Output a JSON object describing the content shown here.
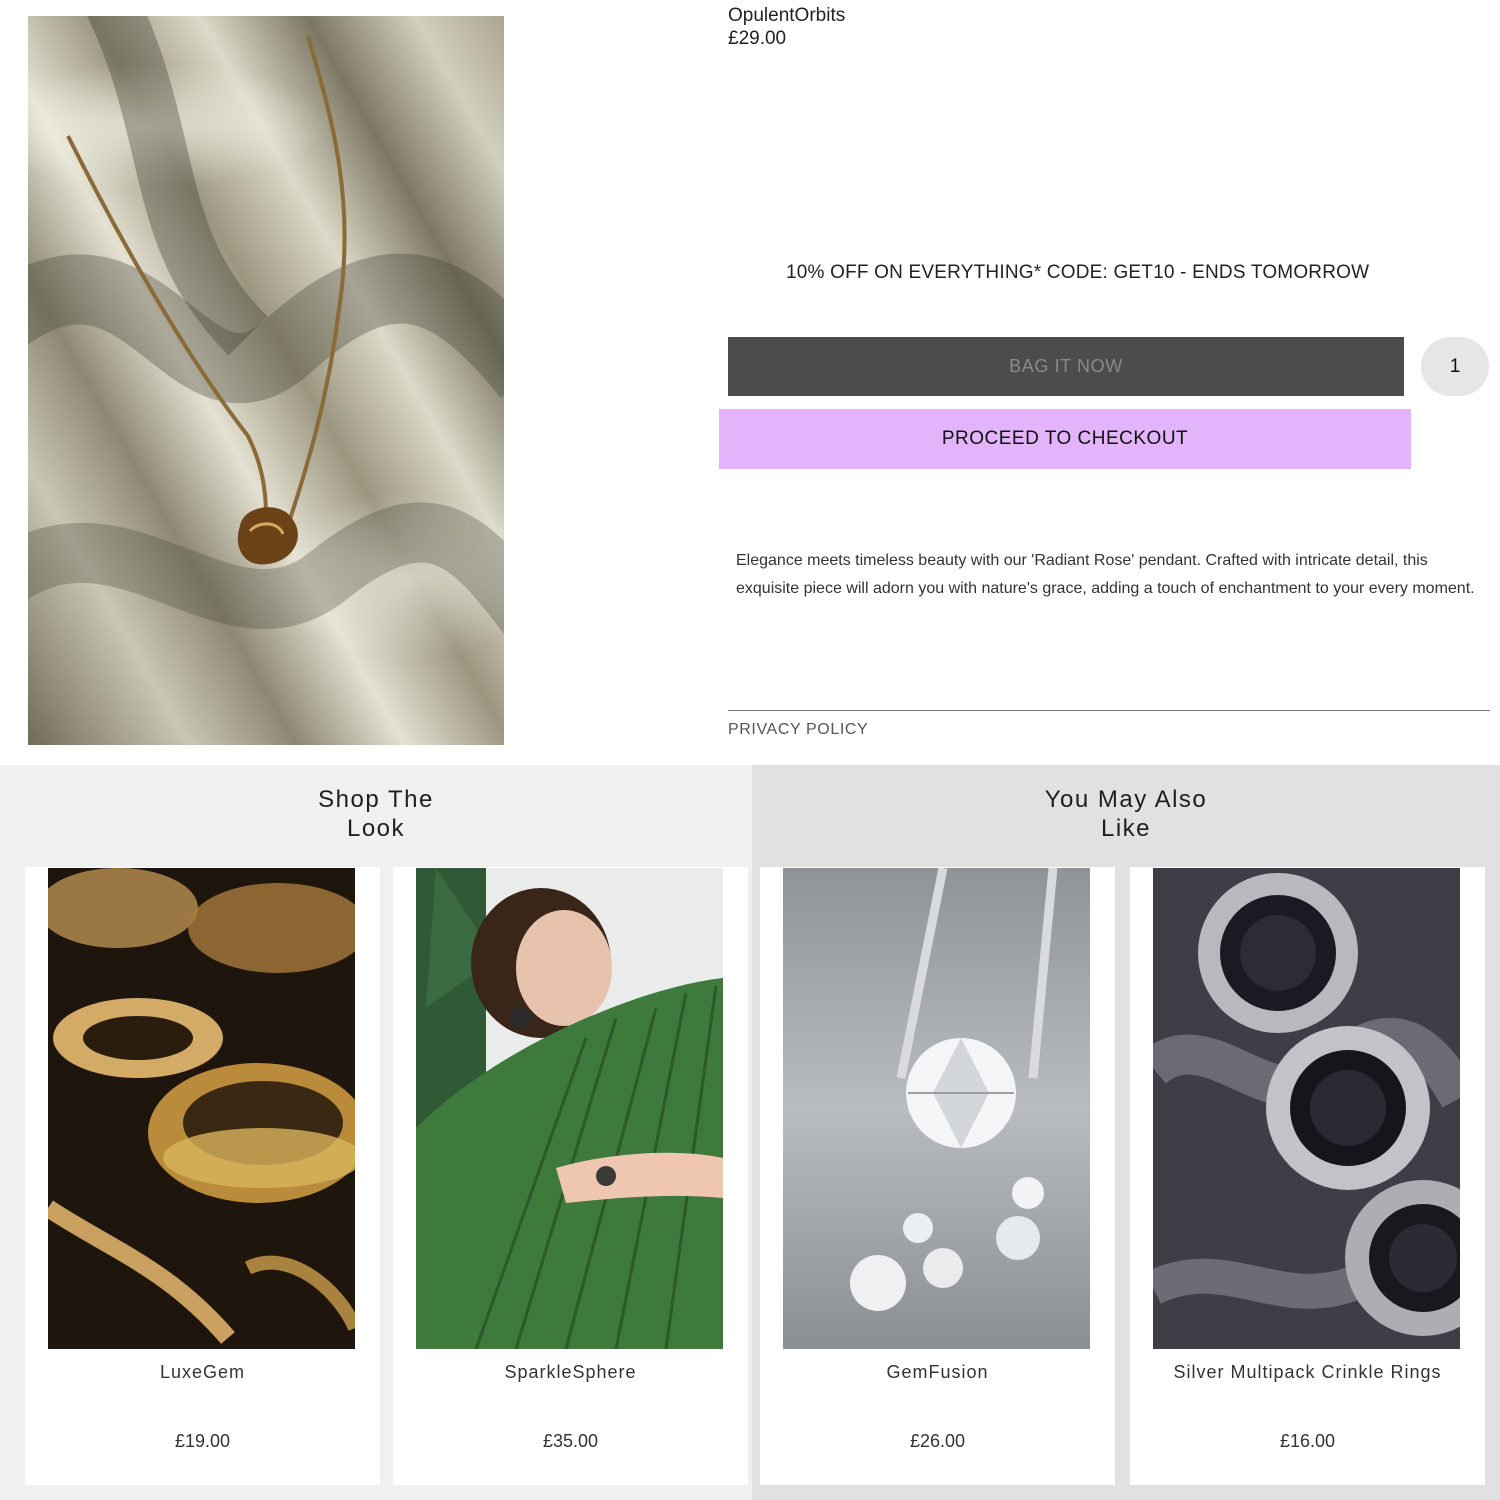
{
  "product": {
    "name": "OpulentOrbits",
    "price": "£29.00",
    "promo": "10% OFF ON EVERYTHING* CODE: GET10 - ENDS TOMORROW",
    "bag_button": "BAG IT NOW",
    "quantity": "1",
    "checkout_button": "PROCEED TO CHECKOUT",
    "description": "Elegance meets timeless beauty with our 'Radiant Rose' pendant. Crafted with intricate detail, this exquisite piece will adorn you with nature's grace, adding a touch of enchantment to your every moment.",
    "privacy_link": "PRIVACY POLICY"
  },
  "shop_the_look": {
    "title_line1": "Shop The",
    "title_line2": "Look",
    "items": [
      {
        "name": "LuxeGem",
        "price": "£19.00"
      },
      {
        "name": "SparkleSphere",
        "price": "£35.00"
      }
    ]
  },
  "you_may_also_like": {
    "title_line1": "You May Also",
    "title_line2": "Like",
    "items": [
      {
        "name": "GemFusion",
        "price": "£26.00"
      },
      {
        "name": "Silver Multipack Crinkle Rings",
        "price": "£16.00"
      }
    ]
  },
  "colors": {
    "bag_button_bg": "#4c4c4c",
    "checkout_button_bg": "#e3b4fc",
    "left_section_bg": "#f0f0f0",
    "right_section_bg": "#e1e1e1"
  }
}
